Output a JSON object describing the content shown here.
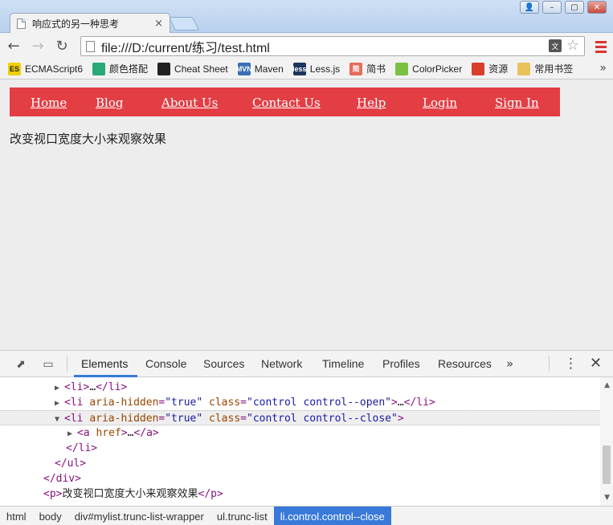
{
  "browser": {
    "tab_title": "响应式的另一种思考",
    "tab_close": "×",
    "url": "file:///D:/current/练习/test.html",
    "window_buttons": [
      "👤",
      "–",
      "▢",
      "✕"
    ]
  },
  "bookmarks": [
    {
      "label": "ECMAScript6",
      "icon": "es-icon",
      "icon_text": "ES",
      "color": "#f0d000"
    },
    {
      "label": "颜色搭配",
      "icon": "leaf-icon",
      "icon_text": "",
      "color": "#2aa876"
    },
    {
      "label": "Cheat Sheet",
      "icon": "github-icon",
      "icon_text": "",
      "color": "#222222"
    },
    {
      "label": "Maven",
      "icon": "maven-icon",
      "icon_text": "MVN",
      "color": "#3b6fb6"
    },
    {
      "label": "Less.js",
      "icon": "less-icon",
      "icon_text": "less",
      "color": "#1d365d"
    },
    {
      "label": "简书",
      "icon": "jianshu-icon",
      "icon_text": "简",
      "color": "#e66b5b"
    },
    {
      "label": "ColorPicker",
      "icon": "colorpicker-icon",
      "icon_text": "",
      "color": "#7ac143"
    },
    {
      "label": "资源",
      "icon": "resource-icon",
      "icon_text": "",
      "color": "#d8402b"
    },
    {
      "label": "常用书签",
      "icon": "folder-icon",
      "icon_text": "",
      "color": "#e8c35a"
    }
  ],
  "bookmarks_more": "»",
  "page": {
    "nav_color": "#e23e44",
    "nav_links": [
      "Home",
      "Blog",
      "About Us",
      "Contact Us",
      "Help",
      "Login",
      "Sign In"
    ],
    "text": "改变视口宽度大小来观察效果"
  },
  "devtools": {
    "tabs": [
      "Elements",
      "Console",
      "Sources",
      "Network",
      "Timeline",
      "Profiles",
      "Resources"
    ],
    "active_tab": "Elements",
    "more": "»",
    "accent": "#3879d9",
    "dom": {
      "l1": {
        "tri": "▶",
        "open": "<li>",
        "ellipsis": "…",
        "close": "</li>"
      },
      "l2": {
        "tri": "▶",
        "tag": "<li",
        "a1": "aria-hidden",
        "v1": "\"true\"",
        "a2": "class",
        "v2": "\"control  control--open\"",
        "end": ">",
        "ellipsis": "…",
        "close": "</li>"
      },
      "l3": {
        "tri": "▼",
        "tag": "<li",
        "a1": "aria-hidden",
        "v1": "\"true\"",
        "a2": "class",
        "v2": "\"control  control--close\"",
        "end": ">"
      },
      "l4": {
        "tri": "▶",
        "tag": "<a",
        "a1": "href",
        "end": ">",
        "ellipsis": "…",
        "close": "</a>"
      },
      "l5": {
        "close": "</li>"
      },
      "l6": {
        "close": "</ul>"
      },
      "l7": {
        "close": "</div>"
      },
      "l8": {
        "open": "<p>",
        "text": "改变视口宽度大小来观察效果",
        "close": "</p>"
      }
    },
    "breadcrumbs": [
      "html",
      "body",
      "div#mylist.trunc-list-wrapper",
      "ul.trunc-list",
      "li.control.control--close"
    ]
  }
}
